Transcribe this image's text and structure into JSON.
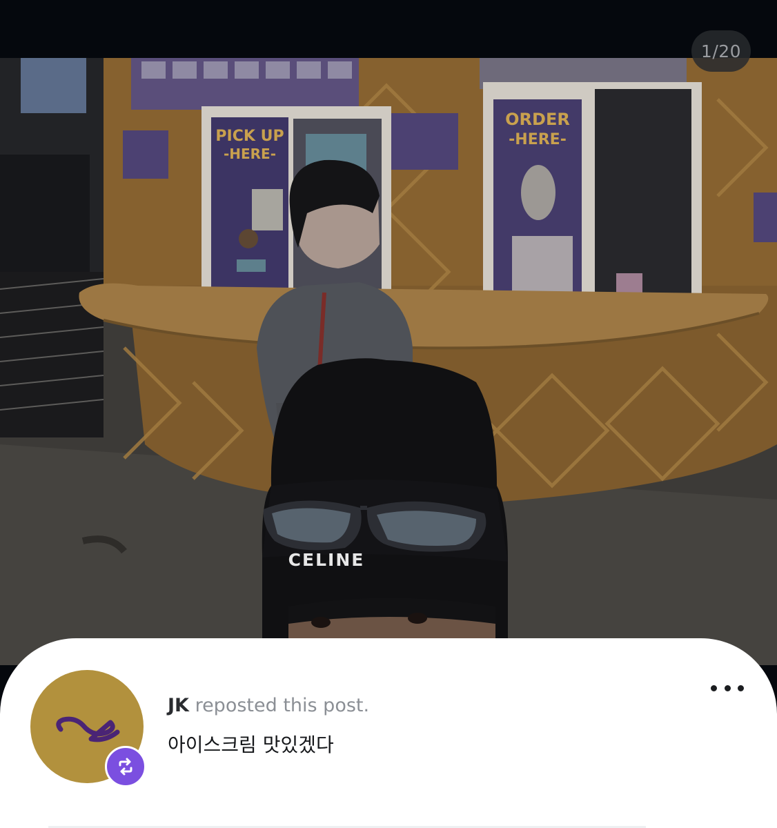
{
  "viewer": {
    "counter": "1/20"
  },
  "photo": {
    "signs": {
      "pickup_line1": "PICK UP",
      "pickup_line2": "-HERE-",
      "order_line1": "ORDER",
      "order_line2": "-HERE-"
    },
    "beanie_brand": "CELINE"
  },
  "post": {
    "author": "JK",
    "action": "reposted this post.",
    "text": "아이스크림 맛있겠다"
  },
  "colors": {
    "accent": "#7b4fe0",
    "avatar_bg": "#b2913d",
    "kiosk": "#8a6430"
  },
  "icons": {
    "more": "more-horizontal-icon",
    "repost": "repost-icon"
  }
}
